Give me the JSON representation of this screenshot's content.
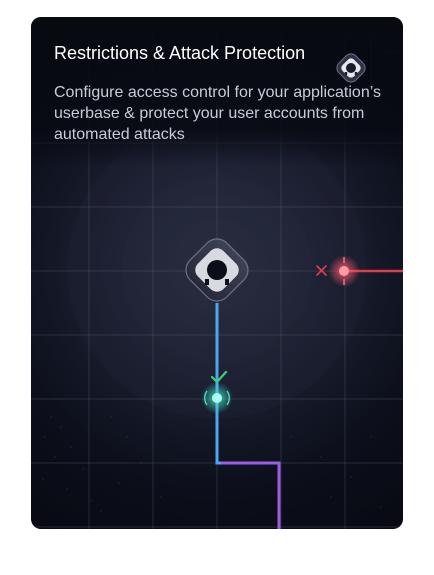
{
  "card": {
    "title": "Restrictions & Attack Protection",
    "description": "Configure access control for your application’s userbase & protect your user accounts from automated attacks"
  },
  "icons": {
    "brand": "auth0-shield-icon",
    "check": "checkmark-icon",
    "blocked": "x-icon"
  },
  "colors": {
    "background": "#0b0e19",
    "allowed_path": "#4aa8f0",
    "blocked_path": "#e23b4a",
    "accent_node": "#3ee0c6",
    "secondary_path": "#9a5fe0"
  }
}
